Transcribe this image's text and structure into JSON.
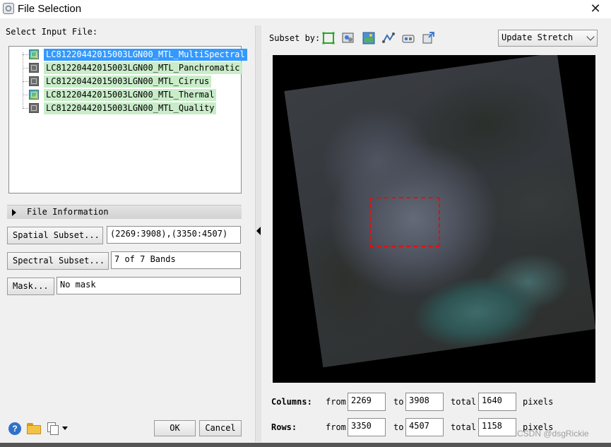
{
  "window": {
    "title": "File Selection",
    "close_icon": "close-icon"
  },
  "left_panel": {
    "select_label": "Select Input File:",
    "files": [
      {
        "name": "LC81220442015003LGN00_MTL_MultiSpectral",
        "selected": true,
        "icon": "multispectral-raster-icon"
      },
      {
        "name": "LC81220442015003LGN00_MTL_Panchromatic",
        "selected": false,
        "icon": "grayscale-raster-icon"
      },
      {
        "name": "LC81220442015003LGN00_MTL_Cirrus",
        "selected": false,
        "icon": "grayscale-raster-icon"
      },
      {
        "name": "LC81220442015003LGN00_MTL_Thermal",
        "selected": false,
        "icon": "multispectral-raster-icon"
      },
      {
        "name": "LC81220442015003LGN00_MTL_Quality",
        "selected": false,
        "icon": "grayscale-raster-icon"
      }
    ],
    "file_information_label": "File Information",
    "spatial_subset_button": "Spatial Subset...",
    "spatial_subset_value": "(2269:3908),(3350:4507)",
    "spectral_subset_button": "Spectral Subset...",
    "spectral_subset_value": "7 of 7 Bands",
    "mask_button": "Mask...",
    "mask_value": "No mask"
  },
  "footer": {
    "ok_label": "OK",
    "cancel_label": "Cancel",
    "icons": [
      "help-icon",
      "open-folder-icon",
      "multi-file-dropdown-icon"
    ]
  },
  "right_panel": {
    "subset_by_label": "Subset by:",
    "tool_icons": [
      "rectangle-subset-icon",
      "image-subset-icon",
      "file-subset-icon",
      "vector-subset-icon",
      "roi-subset-icon",
      "view-subset-icon"
    ],
    "stretch_value": "Update Stretch",
    "colors": {
      "subset_box": "#e01010",
      "selected_file": "#3399ff",
      "file_highlight": "#c9ecc9"
    }
  },
  "dims": {
    "columns_label": "Columns:",
    "rows_label": "Rows:",
    "from_label": "from",
    "to_label": "to",
    "total_label": "total",
    "pixels_label": "pixels",
    "columns": {
      "from": "2269",
      "to": "3908",
      "total": "1640"
    },
    "rows": {
      "from": "3350",
      "to": "4507",
      "total": "1158"
    }
  },
  "watermark": "CSDN @dsgRickie"
}
